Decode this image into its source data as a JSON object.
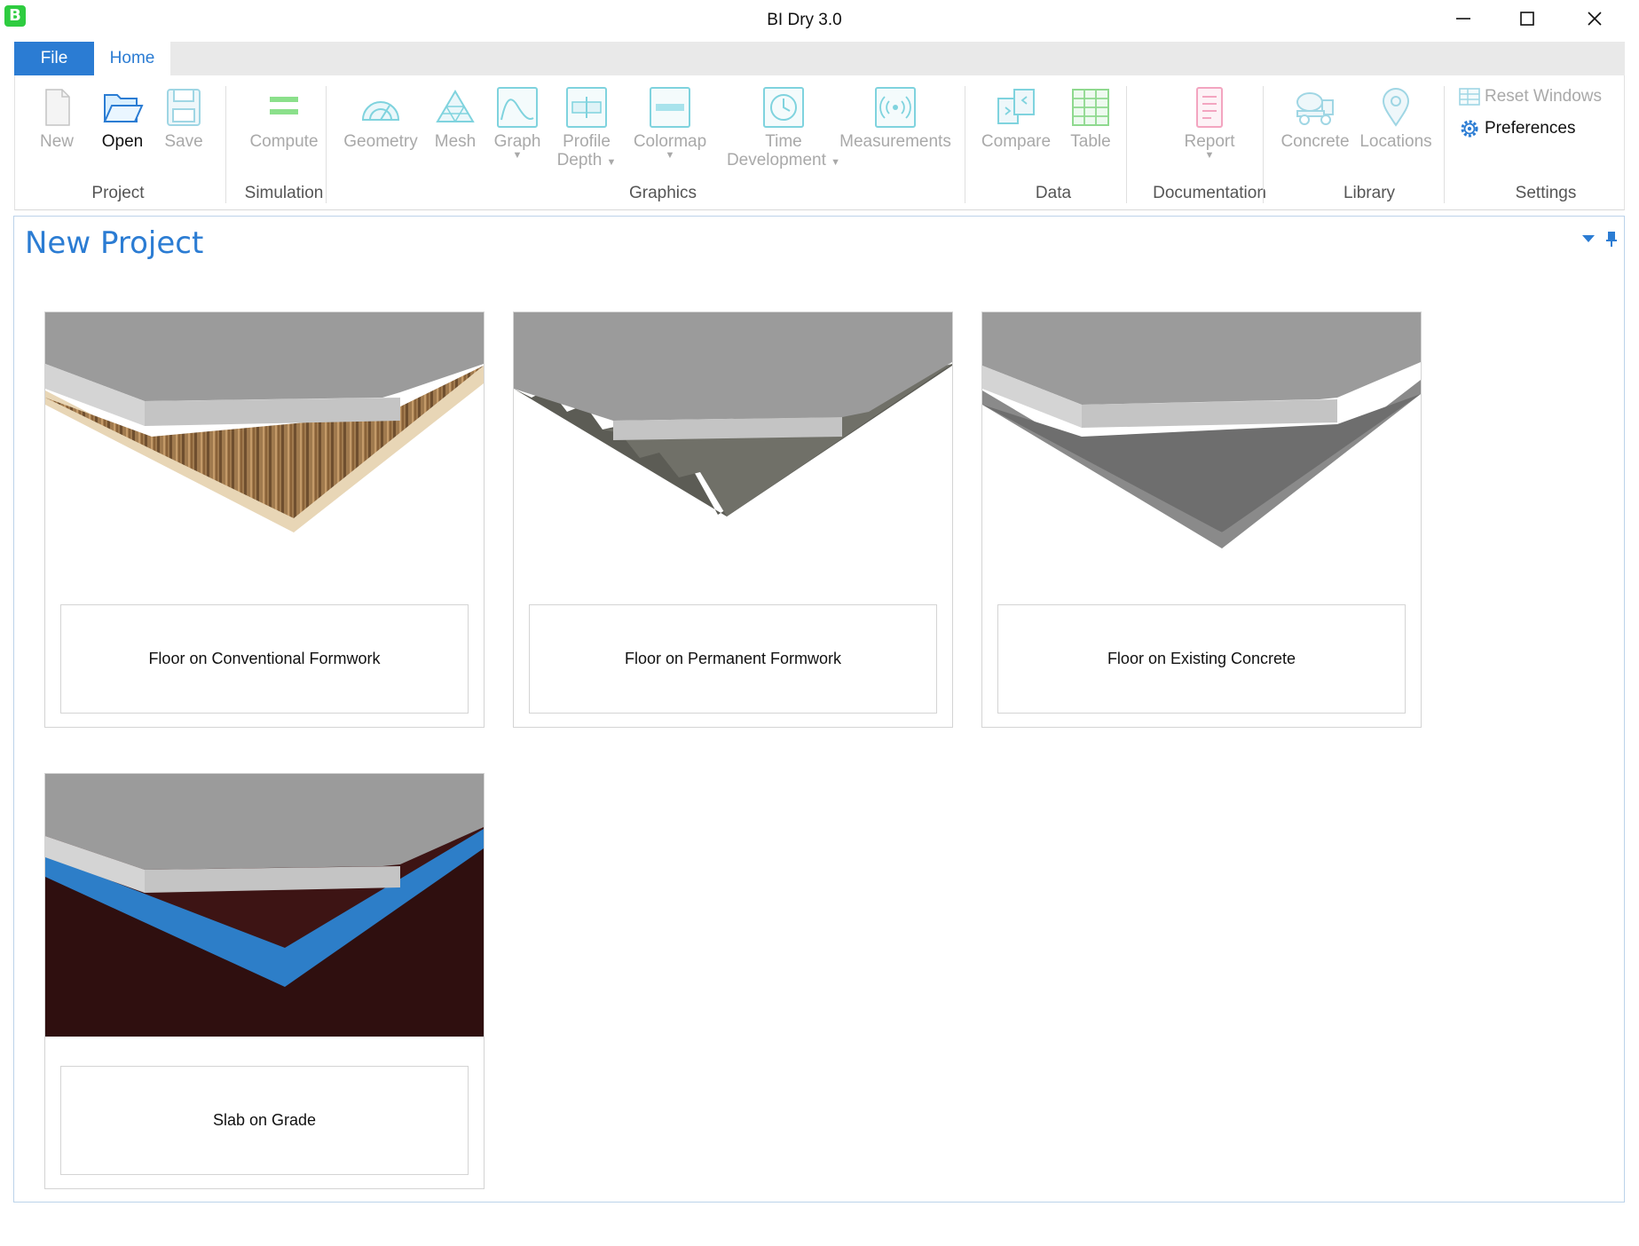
{
  "window": {
    "title": "BI Dry 3.0",
    "logo_letter": "B"
  },
  "ribbon_tabs": [
    {
      "label": "File"
    },
    {
      "label": "Home"
    }
  ],
  "ribbon": {
    "project": {
      "label": "Project",
      "new": "New",
      "open": "Open",
      "save": "Save"
    },
    "simulation": {
      "label": "Simulation",
      "compute": "Compute"
    },
    "graphics": {
      "label": "Graphics",
      "geometry": "Geometry",
      "mesh": "Mesh",
      "graph": "Graph",
      "profile_depth_1": "Profile",
      "profile_depth_2": "Depth",
      "colormap": "Colormap",
      "time_development_1": "Time",
      "time_development_2": "Development",
      "measurements": "Measurements"
    },
    "data": {
      "label": "Data",
      "compare": "Compare",
      "table": "Table"
    },
    "documentation": {
      "label": "Documentation",
      "report": "Report"
    },
    "library": {
      "label": "Library",
      "concrete": "Concrete",
      "locations": "Locations"
    },
    "settings": {
      "label": "Settings",
      "reset_windows": "Reset Windows",
      "preferences": "Preferences"
    },
    "colors": {
      "accent": "#2b7cd3",
      "disabled": "#a9a9a9",
      "icon_teal": "#7fd3de"
    }
  },
  "panel": {
    "title": "New Project",
    "cards": [
      {
        "label": "Floor on Conventional Formwork"
      },
      {
        "label": "Floor on Permanent Formwork"
      },
      {
        "label": "Floor on Existing Concrete"
      },
      {
        "label": "Slab on Grade"
      }
    ]
  }
}
